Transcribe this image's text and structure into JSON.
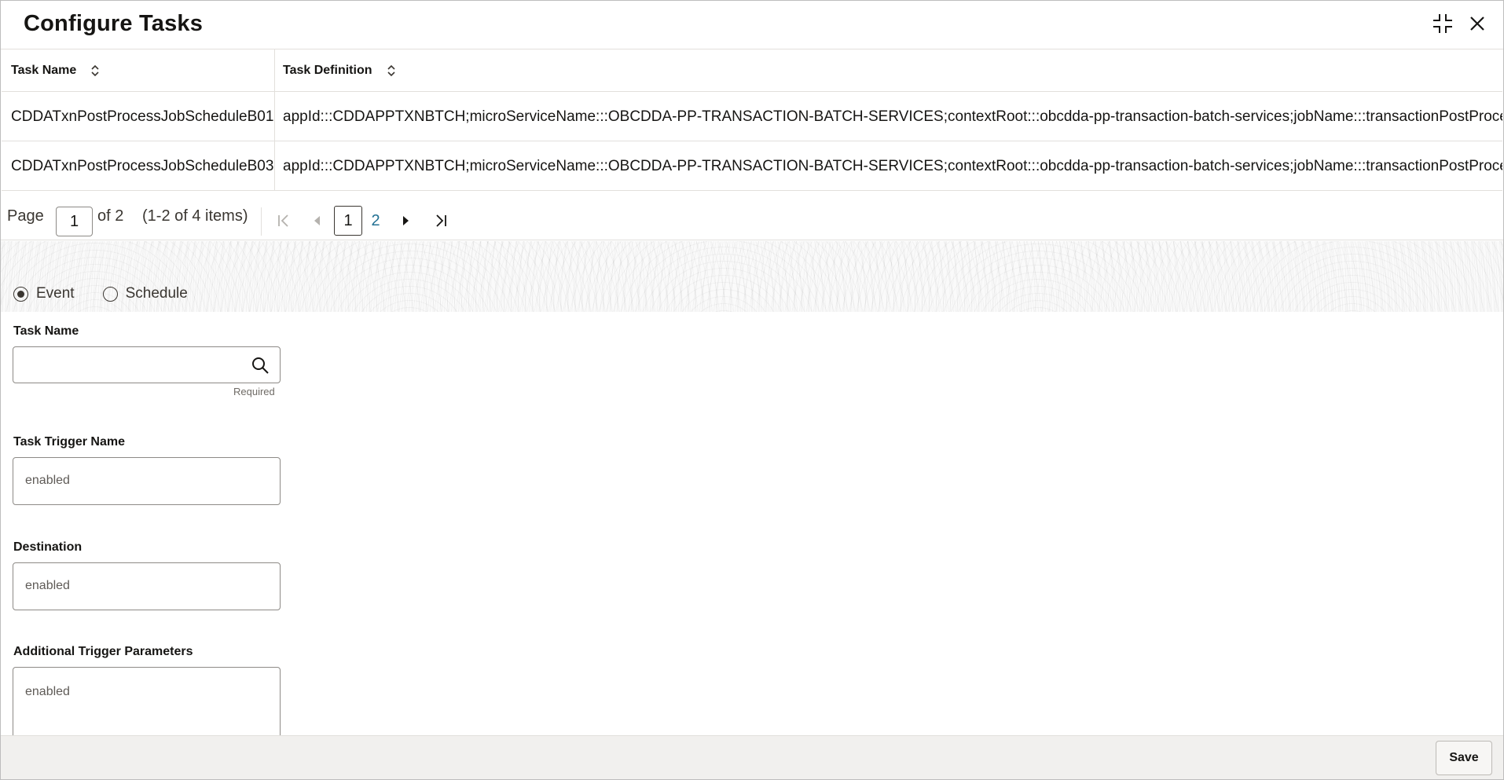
{
  "dialog": {
    "title": "Configure Tasks"
  },
  "table": {
    "headers": {
      "task_name": "Task Name",
      "task_definition": "Task Definition"
    },
    "rows": [
      {
        "task_name": "CDDATxnPostProcessJobScheduleB01",
        "task_definition": "appId:::CDDAPPTXNBTCH;microServiceName:::OBCDDA-PP-TRANSACTION-BATCH-SERVICES;contextRoot:::obcdda-pp-transaction-batch-services;jobName:::transactionPostProcess"
      },
      {
        "task_name": "CDDATxnPostProcessJobScheduleB03",
        "task_definition": "appId:::CDDAPPTXNBTCH;microServiceName:::OBCDDA-PP-TRANSACTION-BATCH-SERVICES;contextRoot:::obcdda-pp-transaction-batch-services;jobName:::transactionPostProcess"
      }
    ]
  },
  "pagination": {
    "page_label": "Page",
    "current_page": "1",
    "of_label": "of 2",
    "items_label": "(1-2 of 4 items)",
    "pages": [
      "1",
      "2"
    ]
  },
  "form": {
    "trigger_type": {
      "options": [
        "Event",
        "Schedule"
      ],
      "selected": "Event"
    },
    "task_name": {
      "label": "Task Name",
      "value": "",
      "helper": "Required"
    },
    "task_trigger_name": {
      "label": "Task Trigger Name",
      "value": "enabled"
    },
    "destination": {
      "label": "Destination",
      "value": "enabled"
    },
    "additional_trigger_parameters": {
      "label": "Additional Trigger Parameters",
      "value": "enabled"
    }
  },
  "footer": {
    "save_label": "Save"
  },
  "colors": {
    "link": "#227093",
    "border": "#8d8a86",
    "footer_bg": "#f1f0ee"
  }
}
